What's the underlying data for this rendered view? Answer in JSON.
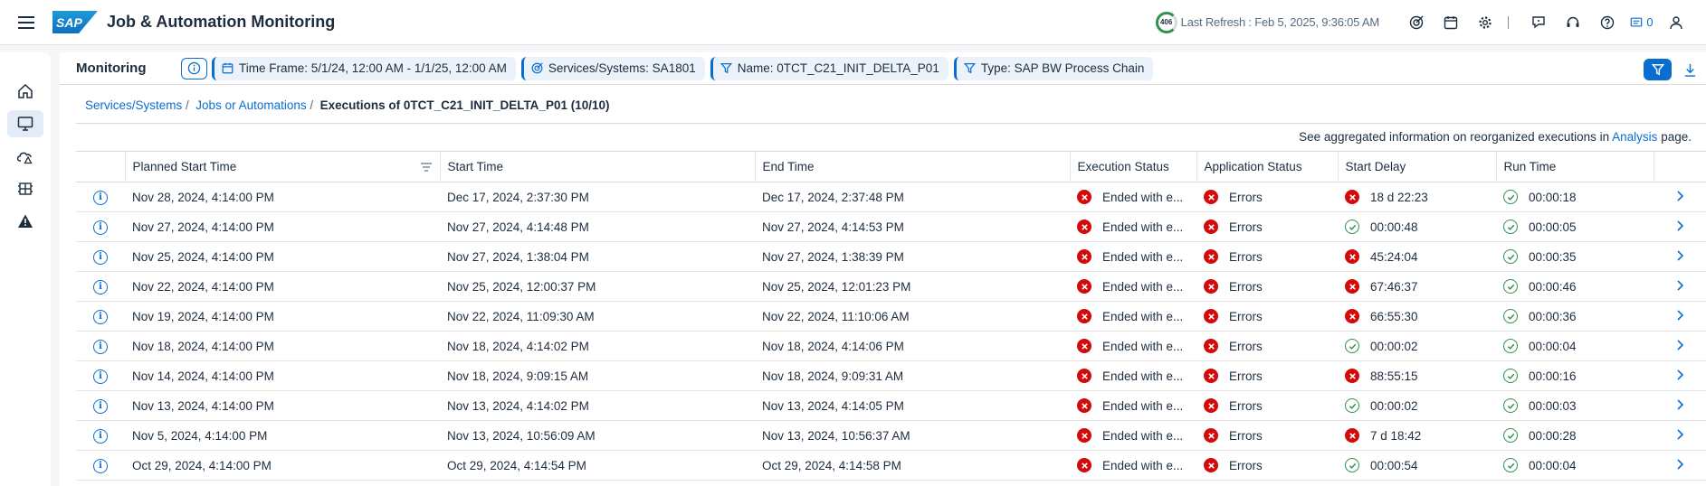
{
  "shell": {
    "title": "Job & Automation Monitoring",
    "logo_text": "SAP",
    "refresh_badge": "406",
    "last_refresh": "Last Refresh : Feb 5, 2025, 9:36:05 AM",
    "notifications_count": "0"
  },
  "filterbar": {
    "title": "Monitoring",
    "chips": [
      "Time Frame: 5/1/24, 12:00 AM - 1/1/25, 12:00 AM",
      "Services/Systems: SA1801",
      "Name: 0TCT_C21_INIT_DELTA_P01",
      "Type: SAP BW Process Chain"
    ]
  },
  "breadcrumb": {
    "item1": "Services/Systems",
    "item2": "Jobs or Automations",
    "current": "Executions of 0TCT_C21_INIT_DELTA_P01 (10/10)"
  },
  "aggregated": {
    "prefix": "See aggregated information on reorganized executions in",
    "link": "Analysis",
    "suffix": "page."
  },
  "table": {
    "columns": [
      "Planned Start Time",
      "Start Time",
      "End Time",
      "Execution Status",
      "Application Status",
      "Start Delay",
      "Run Time"
    ],
    "rows": [
      {
        "planned": "Nov 28, 2024, 4:14:00 PM",
        "start": "Dec 17, 2024, 2:37:30 PM",
        "end": "Dec 17, 2024, 2:37:48 PM",
        "exec": "Ended with e...",
        "app": "Errors",
        "delay": "18 d 22:23",
        "delay_ok": false,
        "run": "00:00:18"
      },
      {
        "planned": "Nov 27, 2024, 4:14:00 PM",
        "start": "Nov 27, 2024, 4:14:48 PM",
        "end": "Nov 27, 2024, 4:14:53 PM",
        "exec": "Ended with e...",
        "app": "Errors",
        "delay": "00:00:48",
        "delay_ok": true,
        "run": "00:00:05"
      },
      {
        "planned": "Nov 25, 2024, 4:14:00 PM",
        "start": "Nov 27, 2024, 1:38:04 PM",
        "end": "Nov 27, 2024, 1:38:39 PM",
        "exec": "Ended with e...",
        "app": "Errors",
        "delay": "45:24:04",
        "delay_ok": false,
        "run": "00:00:35"
      },
      {
        "planned": "Nov 22, 2024, 4:14:00 PM",
        "start": "Nov 25, 2024, 12:00:37 PM",
        "end": "Nov 25, 2024, 12:01:23 PM",
        "exec": "Ended with e...",
        "app": "Errors",
        "delay": "67:46:37",
        "delay_ok": false,
        "run": "00:00:46"
      },
      {
        "planned": "Nov 19, 2024, 4:14:00 PM",
        "start": "Nov 22, 2024, 11:09:30 AM",
        "end": "Nov 22, 2024, 11:10:06 AM",
        "exec": "Ended with e...",
        "app": "Errors",
        "delay": "66:55:30",
        "delay_ok": false,
        "run": "00:00:36"
      },
      {
        "planned": "Nov 18, 2024, 4:14:00 PM",
        "start": "Nov 18, 2024, 4:14:02 PM",
        "end": "Nov 18, 2024, 4:14:06 PM",
        "exec": "Ended with e...",
        "app": "Errors",
        "delay": "00:00:02",
        "delay_ok": true,
        "run": "00:00:04"
      },
      {
        "planned": "Nov 14, 2024, 4:14:00 PM",
        "start": "Nov 18, 2024, 9:09:15 AM",
        "end": "Nov 18, 2024, 9:09:31 AM",
        "exec": "Ended with e...",
        "app": "Errors",
        "delay": "88:55:15",
        "delay_ok": false,
        "run": "00:00:16"
      },
      {
        "planned": "Nov 13, 2024, 4:14:00 PM",
        "start": "Nov 13, 2024, 4:14:02 PM",
        "end": "Nov 13, 2024, 4:14:05 PM",
        "exec": "Ended with e...",
        "app": "Errors",
        "delay": "00:00:02",
        "delay_ok": true,
        "run": "00:00:03"
      },
      {
        "planned": "Nov 5, 2024, 4:14:00 PM",
        "start": "Nov 13, 2024, 10:56:09 AM",
        "end": "Nov 13, 2024, 10:56:37 AM",
        "exec": "Ended with e...",
        "app": "Errors",
        "delay": "7 d 18:42",
        "delay_ok": false,
        "run": "00:00:28"
      },
      {
        "planned": "Oct 29, 2024, 4:14:00 PM",
        "start": "Oct 29, 2024, 4:14:54 PM",
        "end": "Oct 29, 2024, 4:14:58 PM",
        "exec": "Ended with e...",
        "app": "Errors",
        "delay": "00:00:54",
        "delay_ok": true,
        "run": "00:00:04"
      }
    ]
  },
  "colors": {
    "brand": "#0a6ed1",
    "error": "#d20a0a",
    "success": "#30914c"
  },
  "icons": [
    "menu-icon",
    "sap-logo",
    "target-icon",
    "calendar-icon",
    "gear-icon",
    "feedback-icon",
    "headset-icon",
    "help-icon",
    "notification-icon",
    "user-icon",
    "home-icon",
    "monitor-icon",
    "alert-cloud-icon",
    "grid-icon",
    "warning-icon",
    "info-icon",
    "filter-icon",
    "download-icon",
    "sort-icon",
    "error-icon",
    "success-icon",
    "chevron-right-icon"
  ]
}
